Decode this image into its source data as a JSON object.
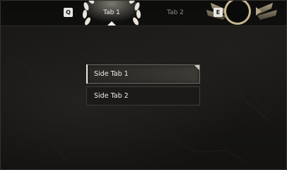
{
  "top_tabs": {
    "prev_key": "Q",
    "next_key": "E",
    "tabs": [
      {
        "label": "Tab 1",
        "selected": true
      },
      {
        "label": "Tab 2",
        "selected": false
      }
    ]
  },
  "side_tabs": [
    {
      "label": "Side Tab 1",
      "selected": true
    },
    {
      "label": "Side Tab 2",
      "selected": false
    }
  ],
  "colors": {
    "background": "#151412",
    "topbar": "#0d0d0c",
    "selected_text": "#f2efe8",
    "unselected_tab_text": "#8f8c86",
    "gold_accent": "#c9b98f"
  }
}
